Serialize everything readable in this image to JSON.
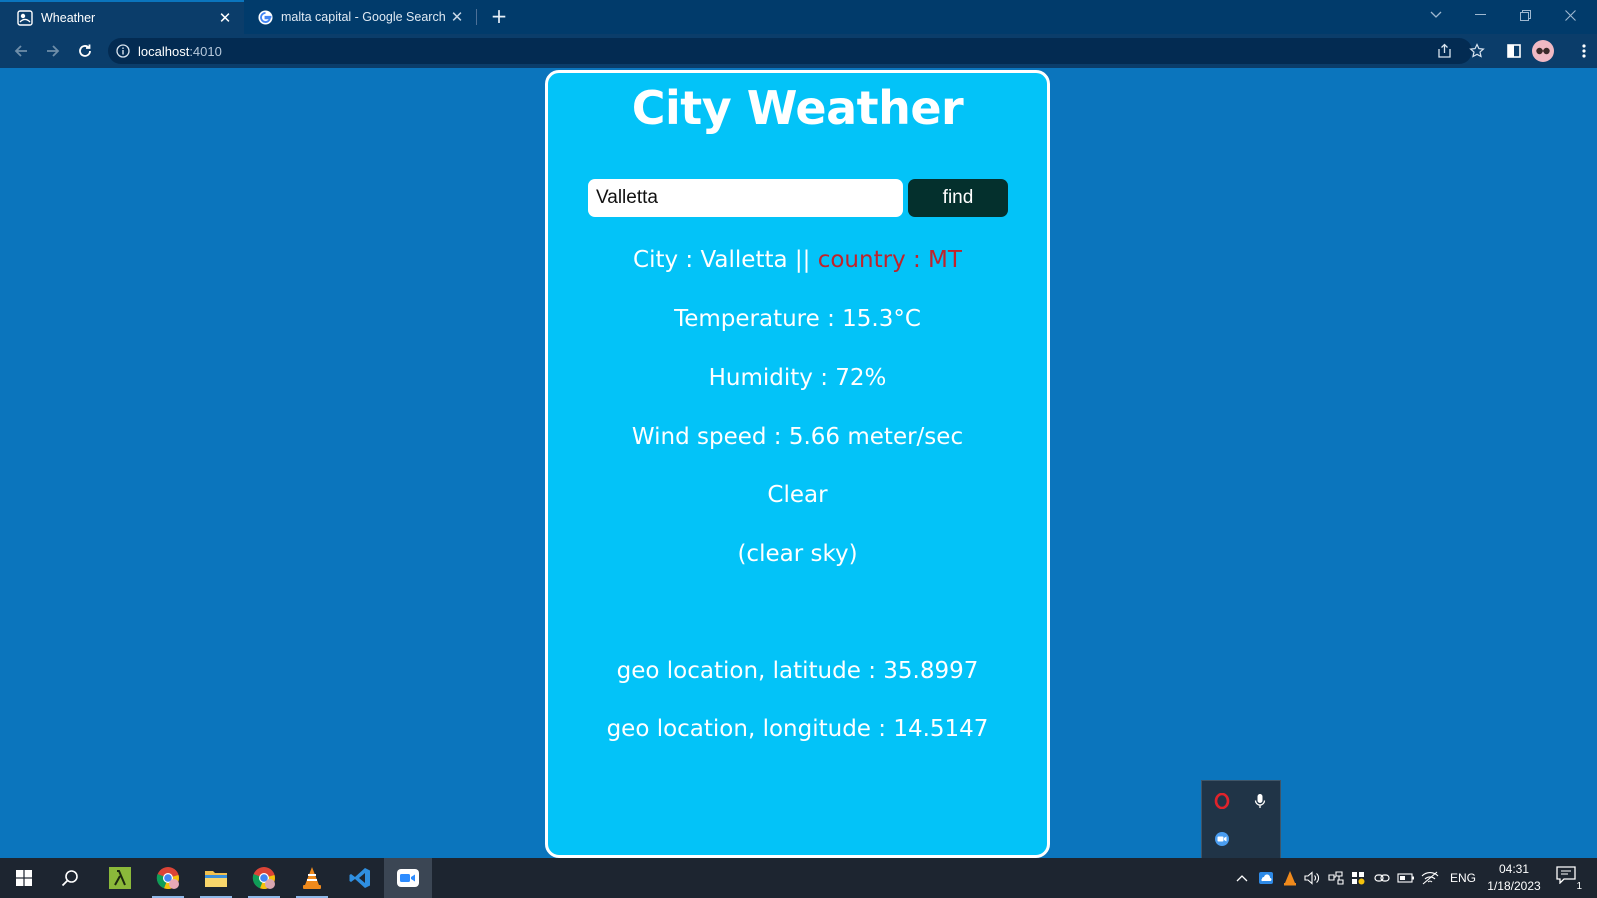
{
  "browser": {
    "tabs": [
      {
        "title": "Wheather",
        "icon": "weather-app-icon",
        "active": true
      },
      {
        "title": "malta capital - Google Search",
        "icon": "google-icon",
        "active": false
      }
    ],
    "url_host": "localhost",
    "url_port": ":4010"
  },
  "page": {
    "title": "City Weather",
    "search_value": "Valletta",
    "find_label": "find",
    "city_text": "City : Valletta ||",
    "country_text": " country : MT",
    "temperature": "Temperature : 15.3°C",
    "humidity": "Humidity : 72%",
    "wind": "Wind speed : 5.66 meter/sec",
    "weather_main": "Clear",
    "weather_desc": "(clear sky)",
    "latitude": "geo location, latitude : 35.8997",
    "longitude": "geo location, longitude : 14.5147"
  },
  "colors": {
    "page_bg": "#0b75bd",
    "card_bg": "#03c3f8",
    "find_button_bg": "#04302d",
    "country_text": "#c0232b"
  },
  "taskbar": {
    "apps": [
      "windows-start",
      "search",
      "lambda-app",
      "chrome",
      "file-explorer",
      "chrome-profile",
      "vlc",
      "vscode",
      "zoom"
    ],
    "language": "ENG",
    "time": "04:31",
    "date": "1/18/2023",
    "notification_count": "1"
  }
}
